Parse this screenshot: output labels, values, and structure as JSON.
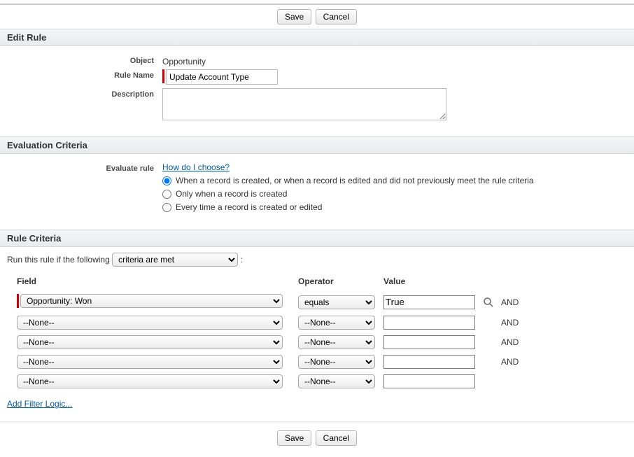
{
  "buttons": {
    "save": "Save",
    "cancel": "Cancel"
  },
  "sections": {
    "editRule": "Edit Rule",
    "evalCriteria": "Evaluation Criteria",
    "ruleCriteria": "Rule Criteria"
  },
  "editRule": {
    "objectLabel": "Object",
    "objectValue": "Opportunity",
    "ruleNameLabel": "Rule Name",
    "ruleNameValue": "Update Account Type",
    "descriptionLabel": "Description",
    "descriptionValue": ""
  },
  "eval": {
    "label": "Evaluate rule",
    "help": "How do I choose?",
    "opt1": "When a record is created, or when a record is edited and did not previously meet the rule criteria",
    "opt2": "Only when a record is created",
    "opt3": "Every time a record is created or edited"
  },
  "criteria": {
    "introPrefix": "Run this rule if the following",
    "introSelect": "criteria are met",
    "colField": "Field",
    "colOperator": "Operator",
    "colValue": "Value",
    "rows": [
      {
        "field": "Opportunity: Won",
        "operator": "equals",
        "value": "True",
        "logic": "AND",
        "required": true,
        "lookup": true
      },
      {
        "field": "--None--",
        "operator": "--None--",
        "value": "",
        "logic": "AND",
        "required": false,
        "lookup": false
      },
      {
        "field": "--None--",
        "operator": "--None--",
        "value": "",
        "logic": "AND",
        "required": false,
        "lookup": false
      },
      {
        "field": "--None--",
        "operator": "--None--",
        "value": "",
        "logic": "AND",
        "required": false,
        "lookup": false
      },
      {
        "field": "--None--",
        "operator": "--None--",
        "value": "",
        "logic": "",
        "required": false,
        "lookup": false
      }
    ],
    "addFilter": "Add Filter Logic..."
  }
}
